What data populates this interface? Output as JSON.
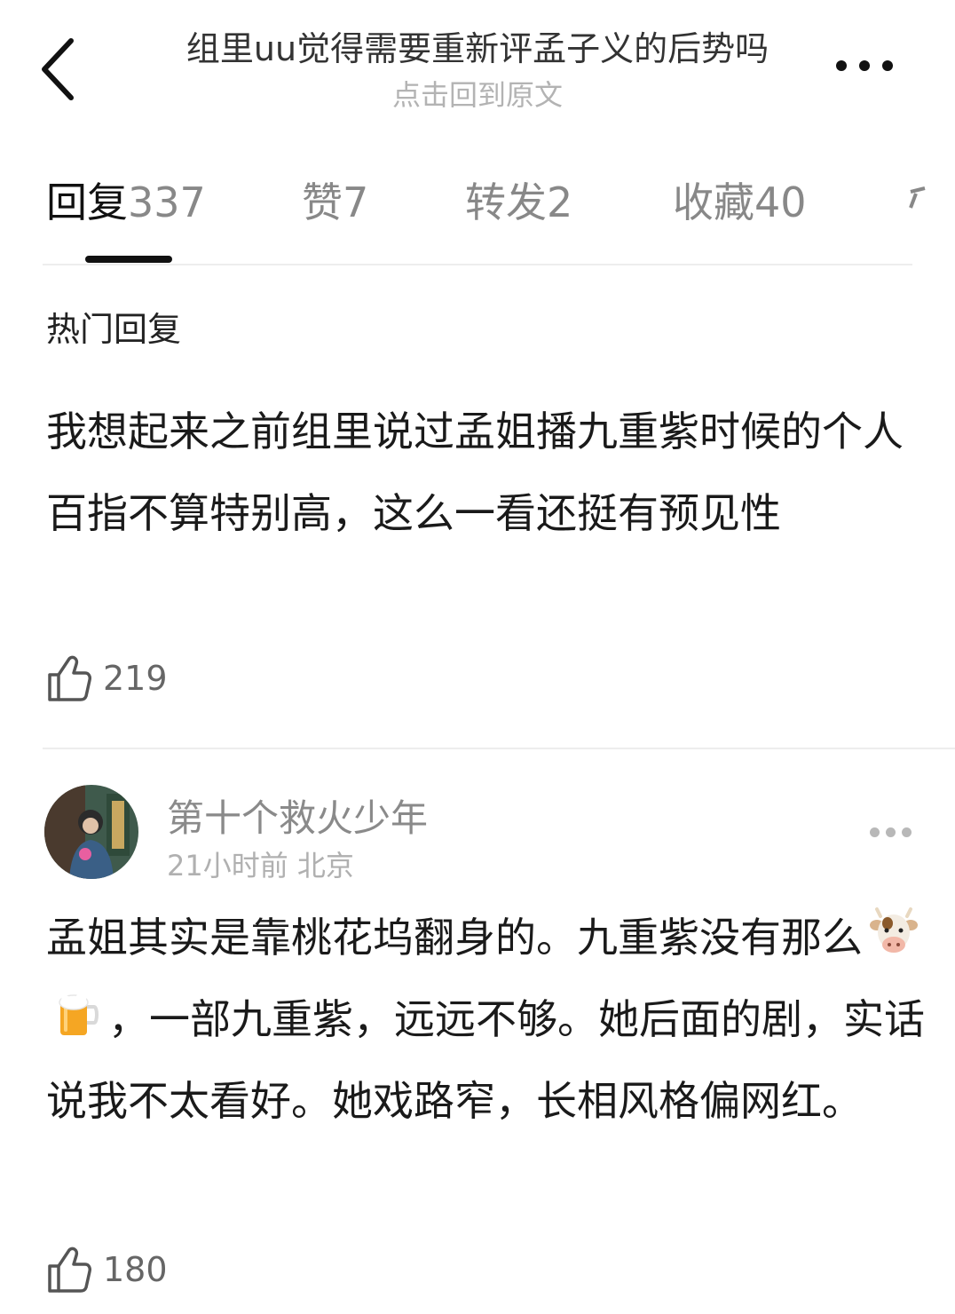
{
  "header": {
    "title": "组里uu觉得需要重新评孟子义的后势吗",
    "subtitle": "点击回到原文"
  },
  "tabs": [
    {
      "label": "回复",
      "count": "337",
      "active": true
    },
    {
      "label": "赞",
      "count": "7",
      "active": false
    },
    {
      "label": "转发",
      "count": "2",
      "active": false
    },
    {
      "label": "收藏",
      "count": "40",
      "active": false
    }
  ],
  "section_title": "热门回复",
  "hot_reply": {
    "text": "我想起来之前组里说过孟姐播九重紫时候的个人百指不算特别高，这么一看还挺有预见性",
    "likes": "219"
  },
  "comment": {
    "username": "第十个救火少年",
    "time": "21小时前",
    "location": "北京",
    "text_part1": "孟姐其实是靠桃花坞翻身的。九重紫没有那么",
    "emojis": [
      "cow-emoji",
      "beer-mug-emoji"
    ],
    "text_part2": "，一部九重紫，远远不够。她后面的剧，实话说我不太看好。她戏路窄，长相风格偏网红。",
    "likes": "180"
  },
  "icons": {
    "back": "chevron-left-icon",
    "more": "more-horizontal-icon",
    "like": "thumbs-up-icon"
  },
  "colors": {
    "text_primary": "#1a1a1a",
    "text_secondary": "#888888",
    "text_tertiary": "#b0b0b0",
    "divider": "#ededed",
    "indicator": "#111111"
  }
}
